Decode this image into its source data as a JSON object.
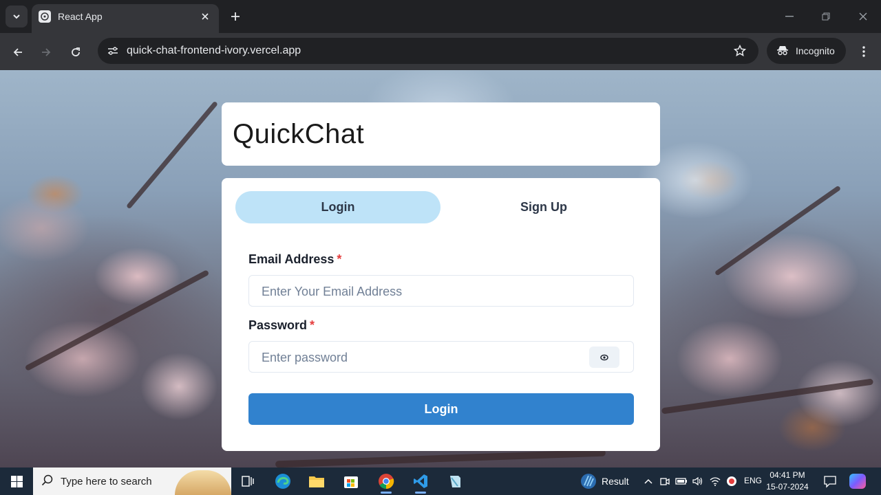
{
  "browser": {
    "tab_title": "React App",
    "url": "quick-chat-frontend-ivory.vercel.app",
    "incognito_label": "Incognito"
  },
  "app": {
    "brand": "QuickChat",
    "tabs": {
      "login": "Login",
      "signup": "Sign Up"
    },
    "email": {
      "label": "Email Address",
      "required_mark": "*",
      "placeholder": "Enter Your Email Address"
    },
    "password": {
      "label": "Password",
      "required_mark": "*",
      "placeholder": "Enter password"
    },
    "submit_label": "Login",
    "colors": {
      "active_tab": "#bee3f8",
      "primary": "#3182ce",
      "required": "#e53e3e"
    }
  },
  "taskbar": {
    "search_placeholder": "Type here to search",
    "weather_label": "Result",
    "language": "ENG",
    "time": "04:41 PM",
    "date": "15-07-2024",
    "apps": [
      "task-view-icon",
      "edge-icon",
      "file-explorer-icon",
      "store-icon",
      "chrome-icon",
      "vscode-icon",
      "notepad-icon"
    ]
  }
}
